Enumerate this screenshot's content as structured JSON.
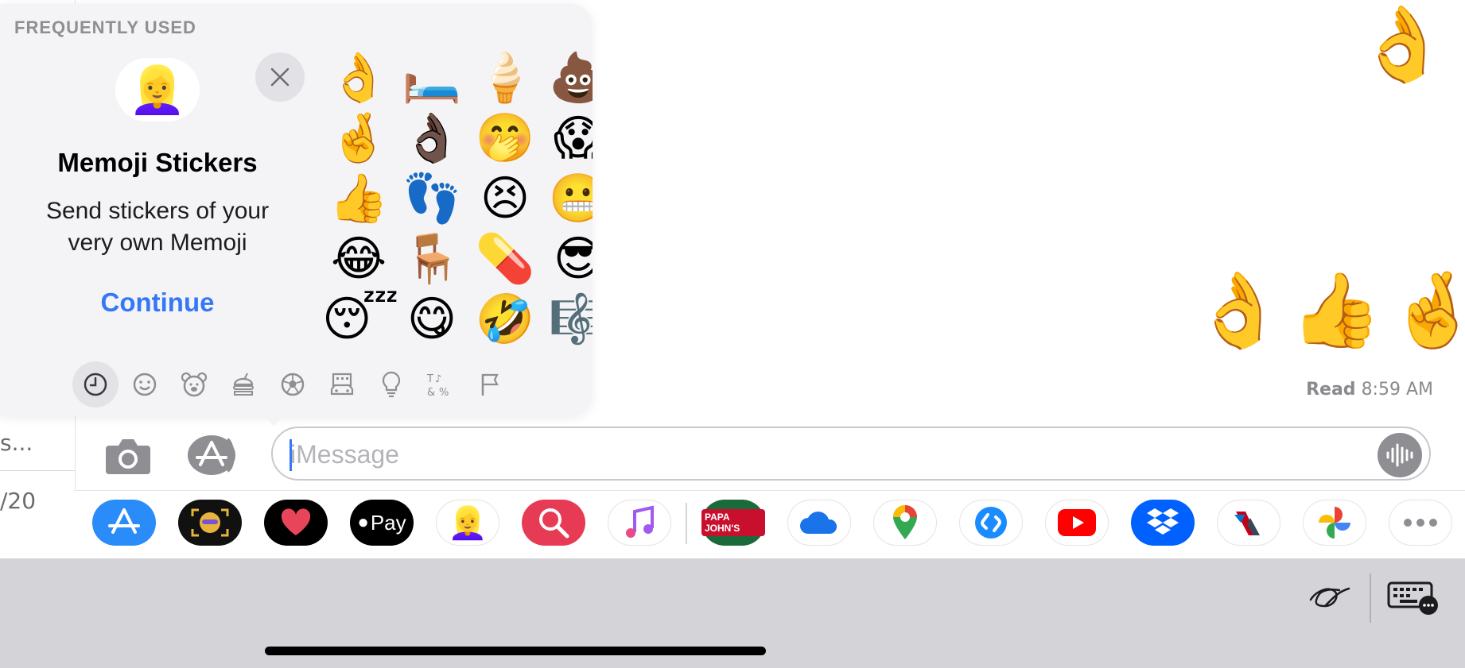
{
  "sidebar": {
    "snippet_1": "s...",
    "snippet_2": "/20"
  },
  "conversation": {
    "message_1": "👌",
    "message_2": [
      "👌",
      "👍",
      "🤞"
    ],
    "read_label": "Read",
    "read_time": "8:59 AM"
  },
  "composer": {
    "placeholder": "iMessage",
    "value": ""
  },
  "apps": [
    {
      "name": "App Store",
      "icon": "app-store-icon"
    },
    {
      "name": "Memoji Camera",
      "icon": "memoji-camera-icon"
    },
    {
      "name": "Digital Touch",
      "icon": "digital-touch-icon"
    },
    {
      "name": "Apple Pay",
      "icon": "apple-pay-icon",
      "label": "Pay"
    },
    {
      "name": "Memoji Stickers",
      "icon": "memoji-stickers-icon"
    },
    {
      "name": "Images Search",
      "icon": "image-search-icon"
    },
    {
      "name": "Music",
      "icon": "music-icon"
    },
    {
      "name": "Papa John's",
      "icon": "papa-johns-icon",
      "label": "PAPA JOHN'S"
    },
    {
      "name": "OneDrive",
      "icon": "onedrive-icon"
    },
    {
      "name": "Google Maps",
      "icon": "google-maps-icon"
    },
    {
      "name": "Shazam",
      "icon": "shazam-icon"
    },
    {
      "name": "YouTube",
      "icon": "youtube-icon"
    },
    {
      "name": "Dropbox",
      "icon": "dropbox-icon"
    },
    {
      "name": "American Airlines",
      "icon": "american-airlines-icon"
    },
    {
      "name": "Google Photos",
      "icon": "google-photos-icon"
    },
    {
      "name": "More",
      "icon": "more-icon"
    }
  ],
  "emoji_popover": {
    "section_title": "FREQUENTLY USED",
    "memoji_promo": {
      "title": "Memoji Stickers",
      "description": "Send stickers of your very own Memoji",
      "continue_label": "Continue"
    },
    "emojis": [
      [
        "👌",
        "🛏️",
        "🍦",
        "💩"
      ],
      [
        "🤞",
        "👌🏿",
        "🤭",
        "😱"
      ],
      [
        "👍",
        "👣",
        "😣",
        "😬"
      ],
      [
        "😂",
        "🪑",
        "💊",
        "😎"
      ],
      [
        "😴",
        "😋",
        "🤣",
        "🎼"
      ]
    ],
    "categories": [
      "Frequently Used",
      "Smileys",
      "Animals",
      "Food",
      "Activity",
      "Travel",
      "Objects",
      "Symbols",
      "Flags"
    ],
    "selected_category": "Frequently Used"
  },
  "colors": {
    "accent": "#3478f6",
    "keyboard_bar": "#d3d3d8",
    "popover_bg": "#f4f4f6"
  }
}
